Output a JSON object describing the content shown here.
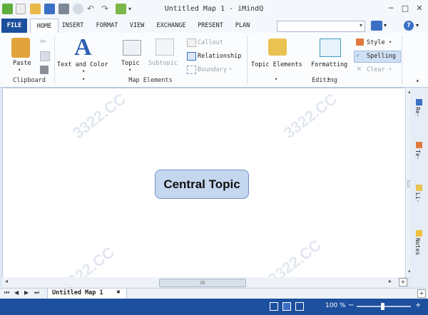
{
  "window": {
    "title": "Untitled Map 1 - iMindQ"
  },
  "tabs": [
    "FILE",
    "HOME",
    "INSERT",
    "FORMAT",
    "VIEW",
    "EXCHANGE",
    "PRESENT",
    "PLAN"
  ],
  "ribbon": {
    "clipboard": {
      "paste": "Paste",
      "group": "Clipboard"
    },
    "map_elements": {
      "text_and_color": "Text and Color",
      "topic": "Topic",
      "subtopic": "Subtopic",
      "callout": "Callout",
      "relationship": "Relationship",
      "boundary": "Boundary",
      "group": "Map Elements"
    },
    "editing": {
      "topic_elements": "Topic Elements",
      "formatting": "Formatting",
      "style": "Style",
      "spelling": "Spelling",
      "clear": "Clear",
      "group": "Editing"
    }
  },
  "canvas": {
    "central_topic": "Central Topic"
  },
  "hscroll": {
    "grip": "III"
  },
  "side_panel": [
    "Re·",
    "Te·",
    "Li·",
    "Notes"
  ],
  "doc_tabs": {
    "active": "Untitled Map 1",
    "close": "✖"
  },
  "status": {
    "zoom": "100 %",
    "minus": "−",
    "plus": "+"
  },
  "watermark": "3322.CC"
}
